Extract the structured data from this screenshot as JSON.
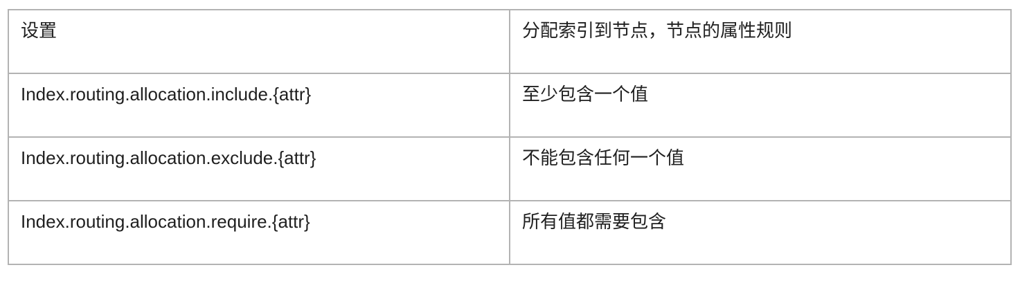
{
  "table": {
    "rows": [
      {
        "setting": "设置",
        "rule": "分配索引到节点，节点的属性规则"
      },
      {
        "setting": "Index.routing.allocation.include.{attr}",
        "rule": "至少包含一个值"
      },
      {
        "setting": "Index.routing.allocation.exclude.{attr}",
        "rule": "不能包含任何一个值"
      },
      {
        "setting": "Index.routing.allocation.require.{attr}",
        "rule": "所有值都需要包含"
      }
    ]
  }
}
